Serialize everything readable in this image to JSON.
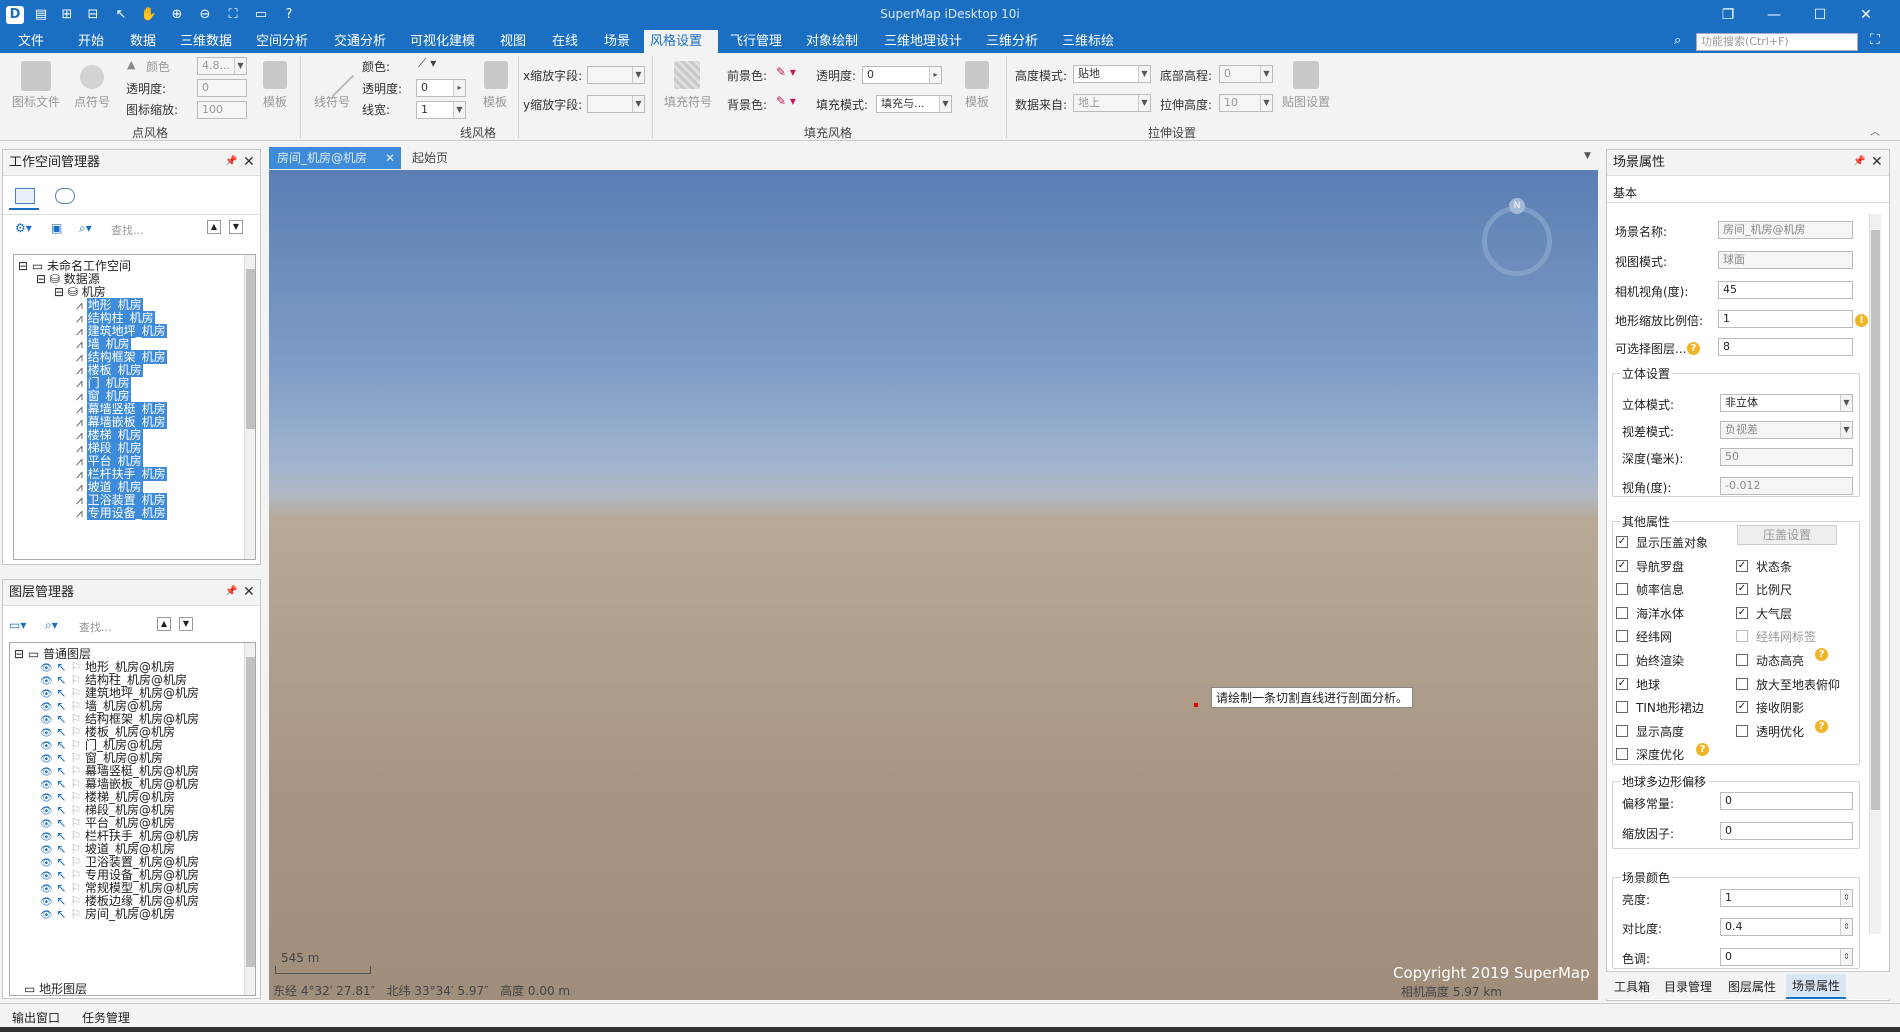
{
  "app": {
    "title": "SuperMap iDesktop 10i"
  },
  "quick_access": [
    "app-logo-icon",
    "save-icon",
    "new-icon",
    "open-icon",
    "pointer-icon",
    "pan-icon",
    "zoom-in-icon",
    "zoom-out-icon",
    "full-extent-icon",
    "folder-icon",
    "help-icon"
  ],
  "menu": {
    "items": [
      "文件",
      "开始",
      "数据",
      "三维数据",
      "空间分析",
      "交通分析",
      "可视化建模",
      "视图",
      "在线",
      "场景",
      "风格设置",
      "飞行管理",
      "对象绘制",
      "三维地理设计",
      "三维分析",
      "三维标绘"
    ],
    "active": "风格设置",
    "search_placeholder": "功能搜索(Ctrl+F)"
  },
  "ribbon": {
    "point_style": {
      "caption": "点风格",
      "btn_icon_file": "图标文件",
      "btn_symbol": "点符号",
      "lbl_color": "颜色",
      "lbl_opacity": "透明度:",
      "lbl_scale": "图标缩放:",
      "val_size": "4.8...",
      "val_opacity": "0",
      "val_scale": "100",
      "btn_template": "模板"
    },
    "line_style": {
      "caption": "线风格",
      "btn_symbol": "线符号",
      "lbl_color": "颜色:",
      "lbl_opacity": "透明度:",
      "lbl_width": "线宽:",
      "val_opacity": "0",
      "val_width": "1",
      "btn_template": "模板"
    },
    "fill_style": {
      "caption": "填充风格",
      "lbl_xscale": "x缩放字段:",
      "lbl_yscale": "y缩放字段:",
      "btn_fill_symbol": "填充符号",
      "lbl_fore": "前景色:",
      "lbl_back": "背景色:",
      "lbl_opacity": "透明度:",
      "val_opacity": "0",
      "lbl_fill_mode": "填充模式:",
      "val_fill_mode": "填充与...",
      "btn_template": "模板"
    },
    "extrude": {
      "caption": "拉伸设置",
      "lbl_height_mode": "高度模式:",
      "val_height_mode": "贴地",
      "lbl_base_height": "底部高程:",
      "val_base_height": "0",
      "lbl_data_from": "数据来自:",
      "val_data_from": "地上",
      "lbl_extrude_height": "拉伸高度:",
      "val_extrude_height": "10",
      "btn_texture": "贴图设置"
    }
  },
  "workspace_panel": {
    "title": "工作空间管理器",
    "search_placeholder": "查找...",
    "root": "未命名工作空间",
    "datasources": "数据源",
    "datasource": "机房",
    "datasets": [
      "地形_机房",
      "结构柱_机房",
      "建筑地坪_机房",
      "墙_机房",
      "结构框架_机房",
      "楼板_机房",
      "门_机房",
      "窗_机房",
      "幕墙竖梃_机房",
      "幕墙嵌板_机房",
      "楼梯_机房",
      "梯段_机房",
      "平台_机房",
      "栏杆扶手_机房",
      "坡道_机房",
      "卫浴装置_机房",
      "专用设备_机房"
    ]
  },
  "layer_panel": {
    "title": "图层管理器",
    "search_placeholder": "查找...",
    "root": "普通图层",
    "layers": [
      "地形_机房@机房",
      "结构柱_机房@机房",
      "建筑地坪_机房@机房",
      "墙_机房@机房",
      "结构框架_机房@机房",
      "楼板_机房@机房",
      "门_机房@机房",
      "窗_机房@机房",
      "幕墙竖梃_机房@机房",
      "幕墙嵌板_机房@机房",
      "楼梯_机房@机房",
      "梯段_机房@机房",
      "平台_机房@机房",
      "栏杆扶手_机房@机房",
      "坡道_机房@机房",
      "卫浴装置_机房@机房",
      "专用设备_机房@机房",
      "常规模型_机房@机房",
      "楼板边缘_机房@机房",
      "房间_机房@机房"
    ],
    "terrain_root": "地形图层"
  },
  "doc_tabs": {
    "active": "房间_机房@机房",
    "other": "起始页"
  },
  "scene": {
    "tooltip": "请绘制一条切割直线进行剖面分析。",
    "scale_value": "545 m",
    "status_coords": "东经 4°32′ 27.81″   北纬 33°34′ 5.97″   高度 0.00 m",
    "copyright": "Copyright 2019 SuperMap",
    "camera_height": "相机高度 5.97 km",
    "compass_label": "N"
  },
  "scene_props": {
    "title": "场景属性",
    "tab": "基本",
    "scene_name_lbl": "场景名称:",
    "scene_name": "房间_机房@机房",
    "view_mode_lbl": "视图模式:",
    "view_mode": "球面",
    "camera_fov_lbl": "相机视角(度):",
    "camera_fov": "45",
    "terrain_scale_lbl": "地形缩放比例倍:",
    "terrain_scale": "1",
    "selectable_lbl": "可选择图层...",
    "selectable": "8",
    "stereo_group": "立体设置",
    "stereo_mode_lbl": "立体模式:",
    "stereo_mode": "非立体",
    "parallax_lbl": "视差模式:",
    "parallax": "负视差",
    "depth_lbl": "深度(毫米):",
    "depth": "50",
    "angle_lbl": "视角(度):",
    "angle": "-0.012",
    "other_group": "其他属性",
    "overlay_settings_btn": "压盖设置",
    "checks": [
      {
        "label": "显示压盖对象",
        "checked": true
      },
      {
        "label": "导航罗盘",
        "checked": true
      },
      {
        "label": "状态条",
        "checked": true
      },
      {
        "label": "帧率信息",
        "checked": false
      },
      {
        "label": "比例尺",
        "checked": true
      },
      {
        "label": "海洋水体",
        "checked": false
      },
      {
        "label": "大气层",
        "checked": true
      },
      {
        "label": "经纬网",
        "checked": false
      },
      {
        "label": "经纬网标签",
        "checked": false
      },
      {
        "label": "始终渲染",
        "checked": false
      },
      {
        "label": "动态高亮",
        "checked": false
      },
      {
        "label": "地球",
        "checked": true
      },
      {
        "label": "放大至地表俯仰",
        "checked": false
      },
      {
        "label": "TIN地形裙边",
        "checked": false
      },
      {
        "label": "接收阴影",
        "checked": true
      },
      {
        "label": "显示高度",
        "checked": false
      },
      {
        "label": "透明优化",
        "checked": false
      },
      {
        "label": "深度优化",
        "checked": false
      }
    ],
    "offset_group": "地球多边形偏移",
    "offset_const_lbl": "偏移常量:",
    "offset_const": "0",
    "scale_factor_lbl": "缩放因子:",
    "scale_factor": "0",
    "color_group": "场景颜色",
    "brightness_lbl": "亮度:",
    "brightness": "1",
    "contrast_lbl": "对比度:",
    "contrast": "0.4",
    "hue_lbl": "色调:",
    "hue": "0",
    "bottom_tabs": [
      "工具箱",
      "目录管理",
      "图层属性",
      "场景属性"
    ],
    "bottom_active": "场景属性"
  },
  "footer": {
    "tabs": [
      "输出窗口",
      "任务管理"
    ]
  }
}
